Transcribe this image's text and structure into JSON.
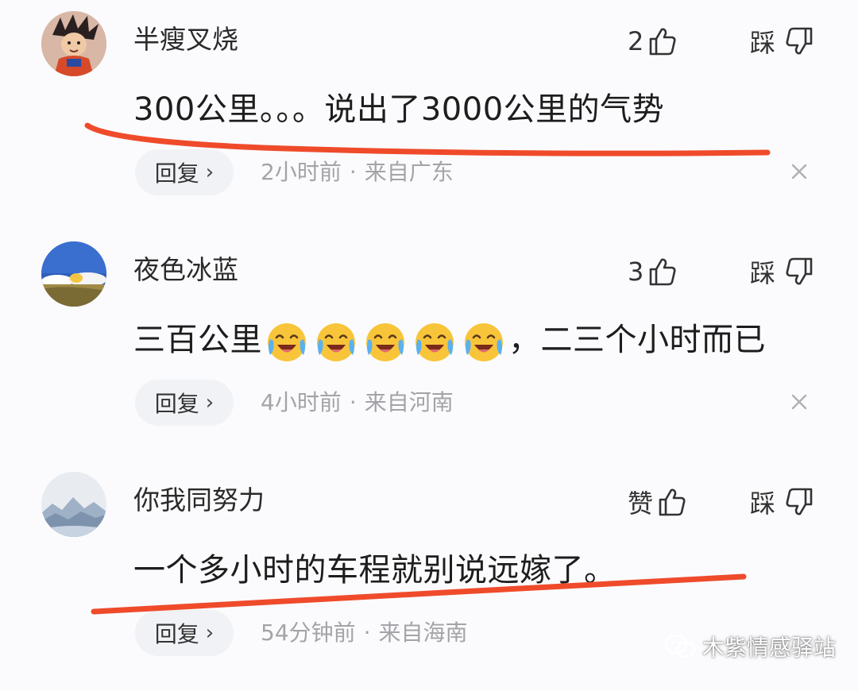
{
  "comments": [
    {
      "username": "半瘦叉烧",
      "like_count": "2",
      "dislike_label": "踩",
      "text": "300公里。。。说出了3000公里的气势",
      "reply_label": "回复",
      "time": "2小时前",
      "location": "来自广东",
      "highlighted": true,
      "avatar_icon": "cartoon-character-avatar"
    },
    {
      "username": "夜色冰蓝",
      "like_count": "3",
      "dislike_label": "踩",
      "text_before": "三百公里",
      "emoji": [
        "laugh-cry-emoji",
        "laugh-cry-emoji",
        "laugh-cry-emoji",
        "laugh-cry-emoji",
        "laugh-cry-emoji"
      ],
      "text_after": "，二三个小时而已",
      "reply_label": "回复",
      "time": "4小时前",
      "location": "来自河南",
      "highlighted": false,
      "avatar_icon": "landscape-sky-avatar"
    },
    {
      "username": "你我同努力",
      "like_count": "赞",
      "dislike_label": "踩",
      "text": "一个多小时的车程就别说远嫁了。",
      "reply_label": "回复",
      "time": "54分钟前",
      "location": "来自海南",
      "highlighted": true,
      "avatar_icon": "mountain-ink-avatar"
    }
  ],
  "separator": "·",
  "watermark": "木紫情感驿站",
  "colors": {
    "highlight": "#ef4b2b",
    "meta": "#a3a3a8",
    "reply_bg": "#f1f2f5"
  }
}
